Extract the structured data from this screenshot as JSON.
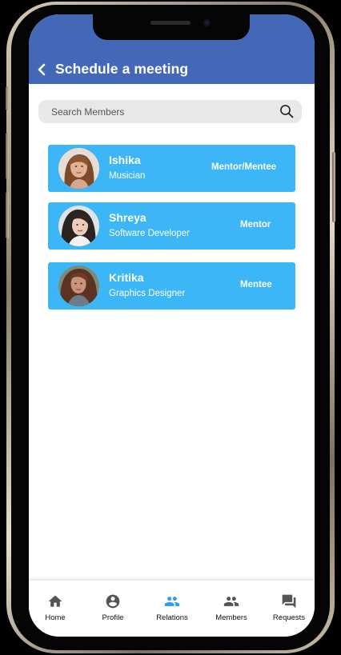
{
  "header": {
    "title": "Schedule a meeting"
  },
  "search": {
    "placeholder": "Search Members",
    "value": ""
  },
  "members": [
    {
      "name": "Ishika",
      "role": "Musician",
      "tag": "Mentor/Mentee"
    },
    {
      "name": "Shreya",
      "role": "Software Developer",
      "tag": "Mentor"
    },
    {
      "name": "Kritika",
      "role": "Graphics Designer",
      "tag": "Mentee"
    }
  ],
  "nav": {
    "items": [
      {
        "label": "Home",
        "icon": "home-icon"
      },
      {
        "label": "Profile",
        "icon": "account-circle-icon"
      },
      {
        "label": "Relations",
        "icon": "people-icon"
      },
      {
        "label": "Members",
        "icon": "people-icon"
      },
      {
        "label": "Requests",
        "icon": "forum-icon"
      }
    ],
    "active": "Relations"
  },
  "colors": {
    "appbar": "#4468b8",
    "card": "#3db6f7",
    "active_nav": "#2a9df4",
    "inactive_nav": "#555555"
  }
}
